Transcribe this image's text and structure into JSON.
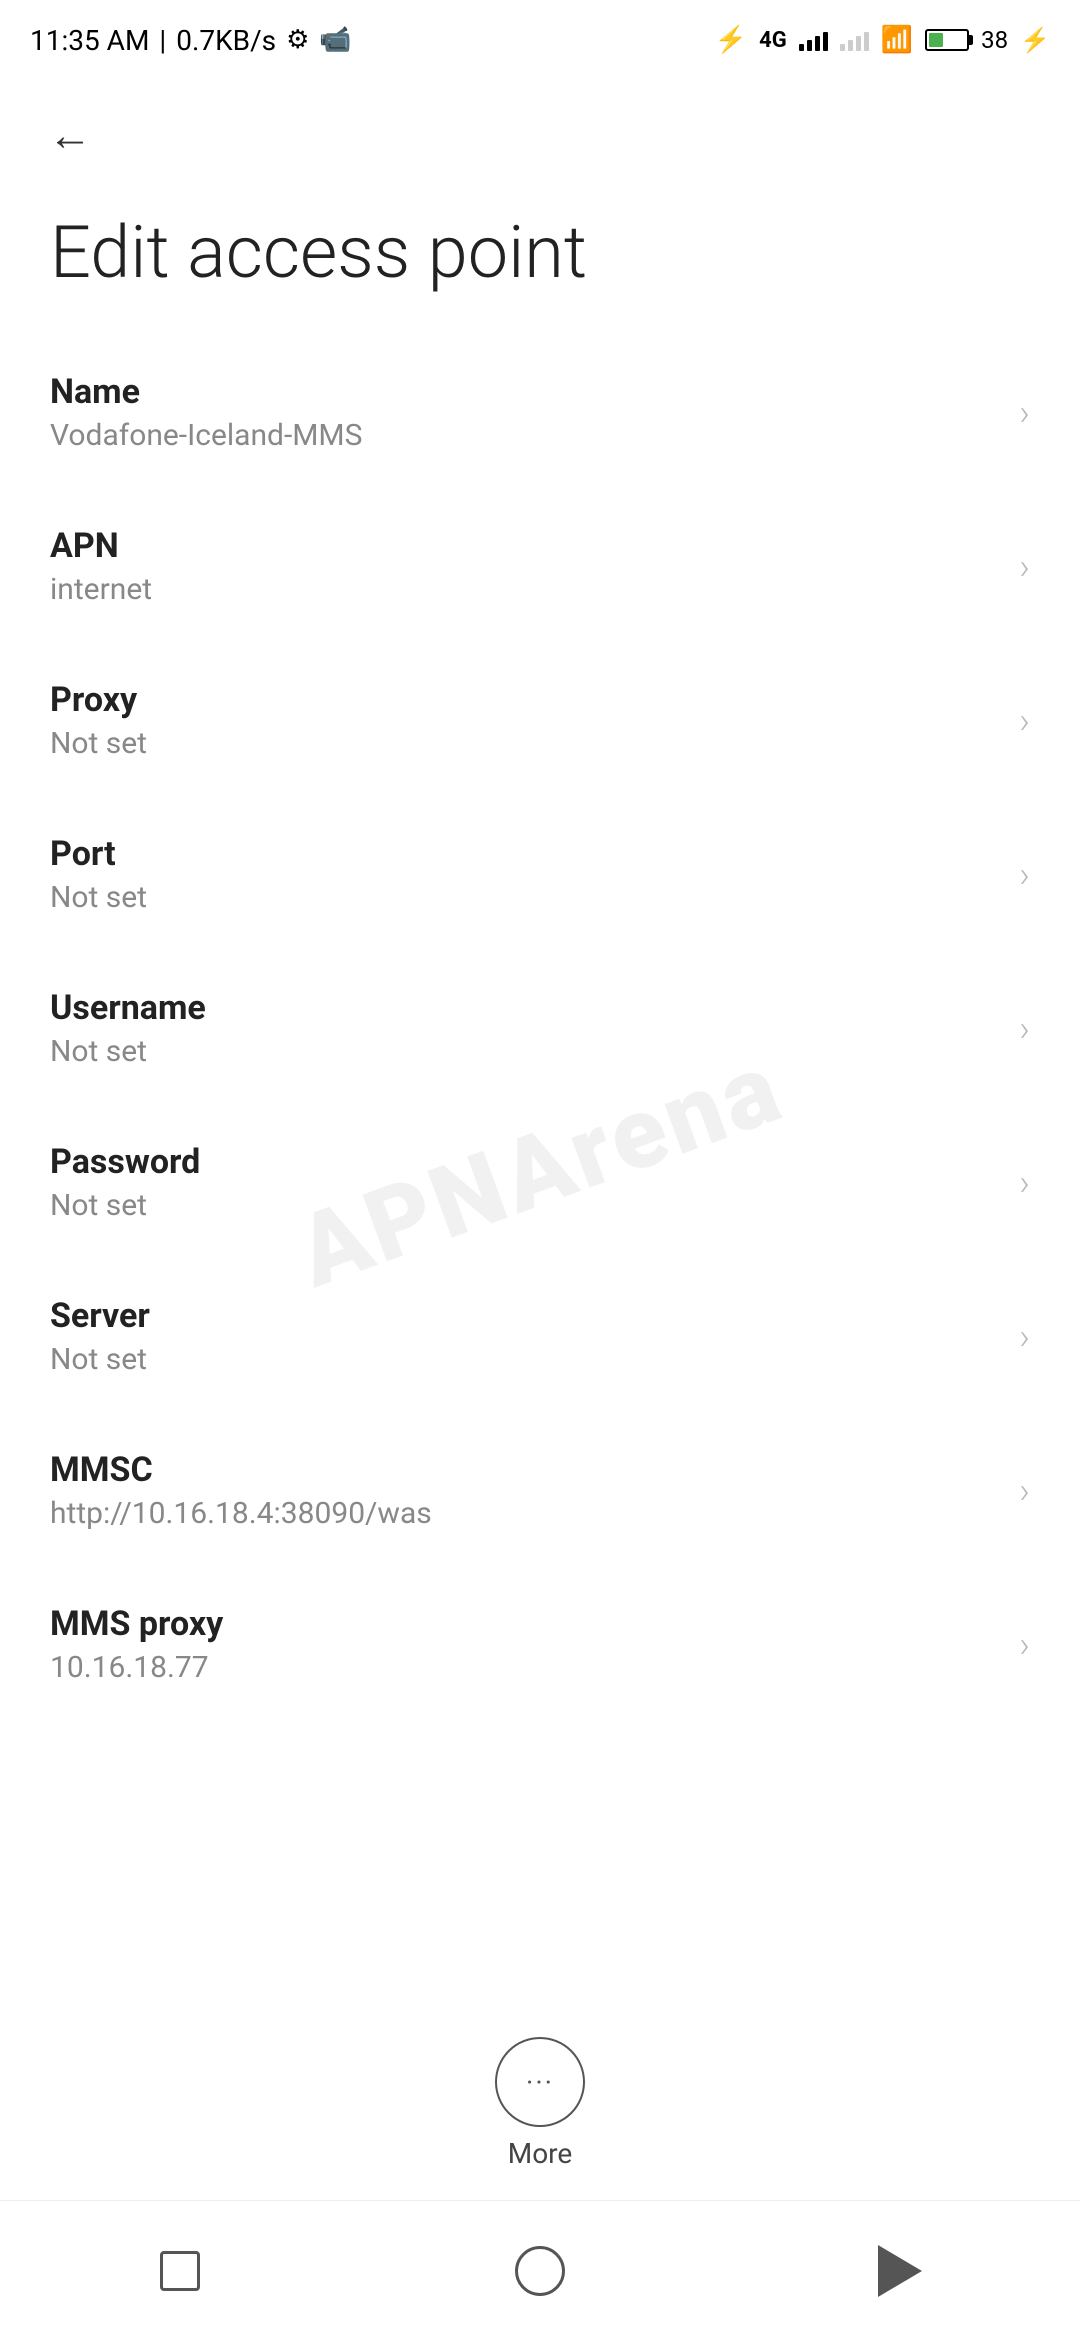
{
  "status_bar": {
    "time": "11:35 AM",
    "network_speed": "0.7KB/s",
    "bluetooth": "⚡",
    "battery_percent": "38"
  },
  "navigation": {
    "back_label": "←"
  },
  "page": {
    "title": "Edit access point"
  },
  "settings_items": [
    {
      "id": "name",
      "label": "Name",
      "value": "Vodafone-Iceland-MMS"
    },
    {
      "id": "apn",
      "label": "APN",
      "value": "internet"
    },
    {
      "id": "proxy",
      "label": "Proxy",
      "value": "Not set"
    },
    {
      "id": "port",
      "label": "Port",
      "value": "Not set"
    },
    {
      "id": "username",
      "label": "Username",
      "value": "Not set"
    },
    {
      "id": "password",
      "label": "Password",
      "value": "Not set"
    },
    {
      "id": "server",
      "label": "Server",
      "value": "Not set"
    },
    {
      "id": "mmsc",
      "label": "MMSC",
      "value": "http://10.16.18.4:38090/was"
    },
    {
      "id": "mms_proxy",
      "label": "MMS proxy",
      "value": "10.16.18.77"
    }
  ],
  "more_button": {
    "label": "More"
  },
  "watermark": {
    "text": "APNArena"
  }
}
